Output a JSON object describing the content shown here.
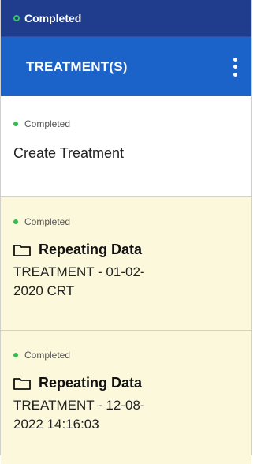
{
  "top_status": {
    "label": "Completed"
  },
  "header": {
    "title": "TREATMENT(S)"
  },
  "items": [
    {
      "status": "Completed",
      "title": "Create Treatment"
    },
    {
      "status": "Completed",
      "type_label": "Repeating Data",
      "detail_line1": "TREATMENT - 01-02-",
      "detail_line2": "2020 CRT"
    },
    {
      "status": "Completed",
      "type_label": "Repeating Data",
      "detail_line1": "TREATMENT - 12-08-",
      "detail_line2": "2022 14:16:03"
    }
  ],
  "colors": {
    "top_bar": "#1f3d8c",
    "header_bar": "#1b62c9",
    "item_highlight": "#fcf8dc",
    "status_dot": "#2fbf4f"
  },
  "icons": {
    "menu": "kebab-vertical-icon",
    "folder": "folder-icon"
  }
}
